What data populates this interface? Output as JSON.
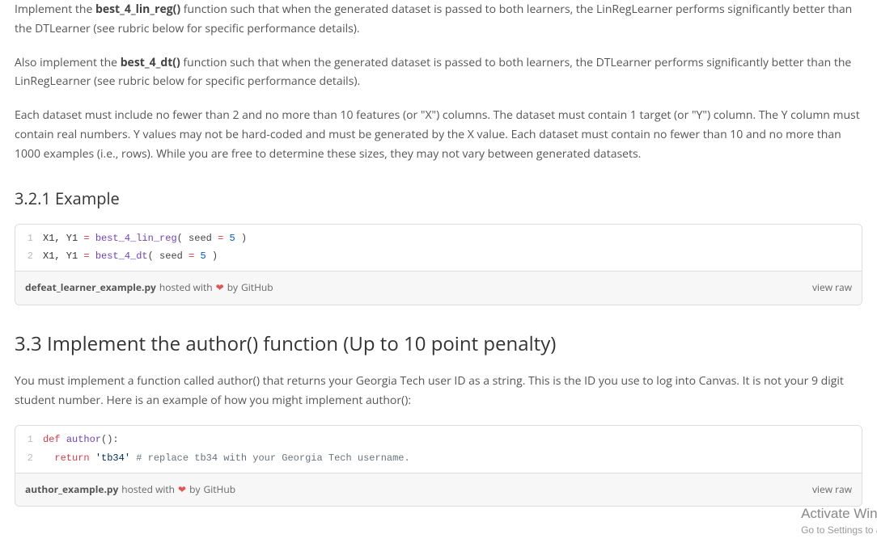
{
  "para1": {
    "pre": "Implement the ",
    "bold": "best_4_lin_reg()",
    "post": " function such that when the generated dataset is passed to both learners, the LinRegLearner performs significantly better than the DTLearner (see rubric below for specific performance details)."
  },
  "para2": {
    "pre": "Also implement the ",
    "bold": "best_4_dt()",
    "post": " function such that when the generated dataset is passed to both learners, the DTLearner performs significantly better than the LinRegLearner (see rubric below for specific performance details)."
  },
  "para3": "Each dataset must include no fewer than 2 and no more than 10 features (or \"X\") columns. The dataset must contain 1 target (or \"Y\") column. The Y column must contain real numbers. Y values may not be hard-coded and must be generated by the X value. Each dataset must contain no fewer than 10 and no more than 1000 examples (i.e., rows). While you are free to determine these sizes, they may not vary between generated datasets.",
  "heading_321": "3.2.1 Example",
  "gist1": {
    "filename": "defeat_learner_example.py",
    "hosted": " hosted with ",
    "by": " by ",
    "github": "GitHub",
    "viewraw": "view raw",
    "lines": [
      {
        "n": "1",
        "vars": "X1, Y1 ",
        "op": "=",
        "fn": " best_4_lin_reg",
        "args_pre": "( seed ",
        "op2": "=",
        "num": " 5",
        "args_post": " )"
      },
      {
        "n": "2",
        "vars": "X1, Y1 ",
        "op": "=",
        "fn": " best_4_dt",
        "args_pre": "( seed ",
        "op2": "=",
        "num": " 5",
        "args_post": " )"
      }
    ]
  },
  "heading_33": "3.3 Implement the author() function (Up to 10 point penalty)",
  "para4": "You must implement a function called author() that returns your Georgia Tech user ID as a string. This is the ID you use to log into Canvas. It is not your 9 digit student number. Here is an example of how you might implement author():",
  "gist2": {
    "filename": "author_example.py",
    "hosted": " hosted with ",
    "by": " by ",
    "github": "GitHub",
    "viewraw": "view raw",
    "lines": [
      {
        "n": "1",
        "kw": "def ",
        "fn": "author",
        "rest": "():"
      },
      {
        "n": "2",
        "indent": "  ",
        "kw": "return ",
        "str": "'tb34'",
        "cm": " # replace tb34 with your Georgia Tech username."
      }
    ]
  },
  "watermark": {
    "line1": "Activate Wind",
    "line2": "Go to Settings to a"
  }
}
